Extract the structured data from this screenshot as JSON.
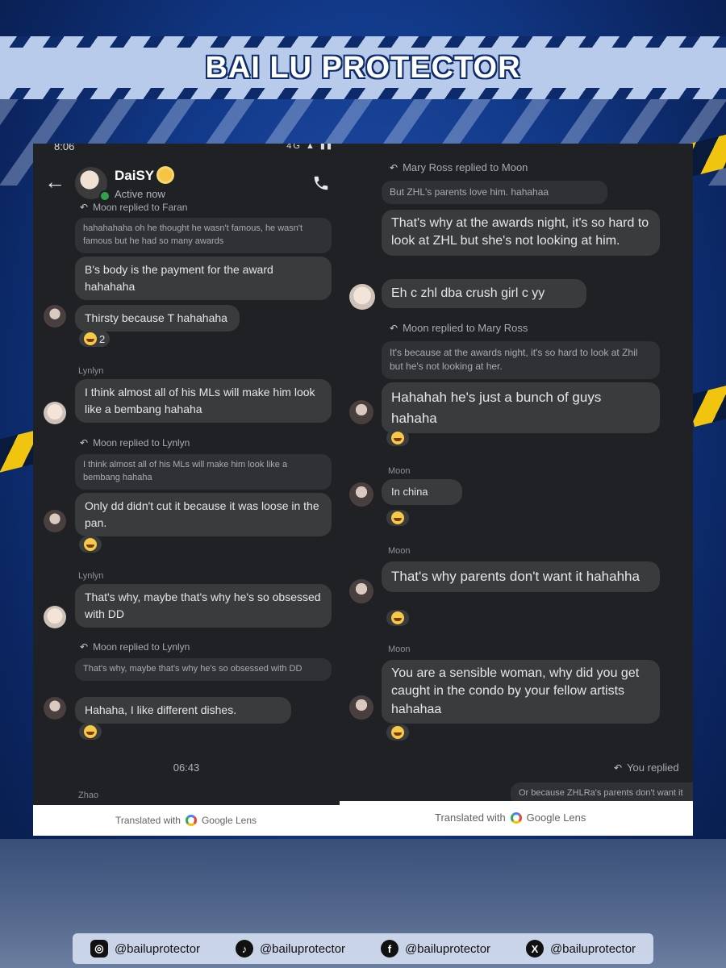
{
  "banner": {
    "title": "BAI LU PROTECTOR"
  },
  "left": {
    "status_time": "8:06",
    "status_icons": "4G  ▲ ▮▮",
    "contact_name": "DaiSY",
    "contact_status": "Active now",
    "messages": {
      "reply1_meta": "Moon replied to Faran",
      "reply1_quote": "hahahahaha oh he thought he wasn't famous, he wasn't famous but he had so many awards",
      "reply1_text": "B's body is the payment for the award hahahaha",
      "msg2_text": "Thirsty because T hahahaha",
      "msg2_react_count": "2",
      "sender_lynlyn_1": "Lynlyn",
      "msg3_text": "I think almost all of his MLs will make him look like a bembang hahaha",
      "reply2_meta": "Moon replied to Lynlyn",
      "reply2_quote": "I think almost all of his MLs will make him look like a bembang hahaha",
      "reply2_text": "Only dd didn't cut it because it was loose in the pan.",
      "sender_lynlyn_2": "Lynlyn",
      "msg4_text": "That's why, maybe that's why he's so obsessed with DD",
      "reply3_meta": "Moon replied to Lynlyn",
      "reply3_quote": "That's why, maybe that's why he's so obsessed with DD",
      "reply3_text": "Hahaha, I like different dishes.",
      "time_sep": "06:43",
      "sender_zhao": "Zhao"
    },
    "footer": "Translated with",
    "footer_brand": "Google Lens"
  },
  "right": {
    "messages": {
      "reply1_meta": "Mary Ross replied to Moon",
      "reply1_quote": "But ZHL's parents love him. hahahaa",
      "reply1_text": "That's why at the awards night, it's so hard to look at ZHL but she's not looking at him.",
      "msg2_text": "Eh c zhl dba crush girl c yy",
      "reply2_meta": "Moon replied to Mary Ross",
      "reply2_quote": "It's because at the awards night, it's so hard to look at Zhil but he's not looking at her.",
      "reply2_text": "Hahahah he's just a bunch of guys hahaha",
      "sender_moon_1": "Moon",
      "msg3_text": "In china",
      "sender_moon_2": "Moon",
      "msg4_text": "That's why parents don't want it hahahha",
      "sender_moon_3": "Moon",
      "msg5_text": "You are a sensible woman, why did you get caught in the condo by your fellow artists hahahaa",
      "you_replied": "You replied",
      "you_quote": "Or because ZHLRa's parents don't want it"
    },
    "footer": "Translated with",
    "footer_brand": "Google Lens"
  },
  "social": [
    {
      "icon": "instagram-icon",
      "glyph": "◎",
      "handle": "@bailuprotector"
    },
    {
      "icon": "tiktok-icon",
      "glyph": "♪",
      "handle": "@bailuprotector"
    },
    {
      "icon": "facebook-icon",
      "glyph": "f",
      "handle": "@bailuprotector"
    },
    {
      "icon": "x-icon",
      "glyph": "X",
      "handle": "@bailuprotector"
    }
  ],
  "colors": {
    "accent": "#0d2a6b",
    "chat_bg": "#202124",
    "bubble": "#3a3b3c",
    "online": "#31a24c"
  }
}
